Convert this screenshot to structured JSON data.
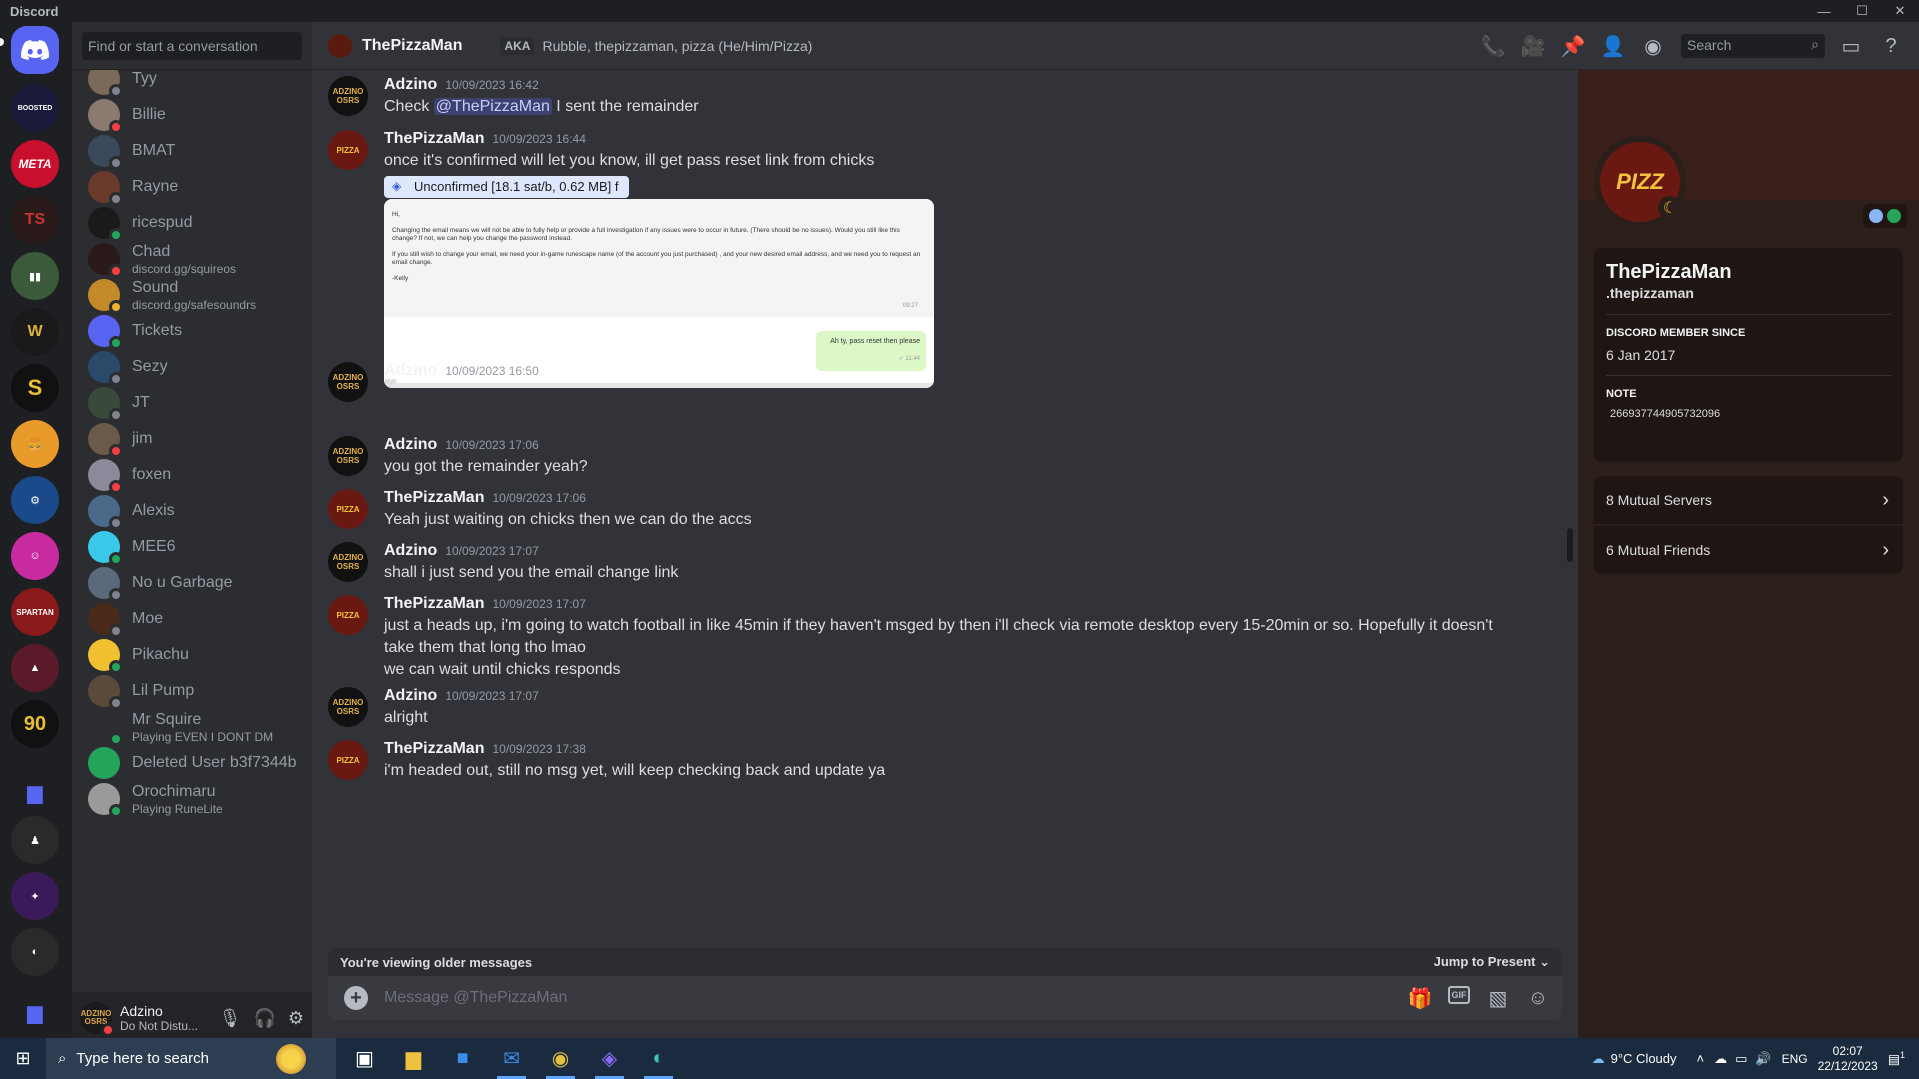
{
  "window": {
    "app_name": "Discord",
    "minimize": "—",
    "maximize": "☐",
    "close": "✕"
  },
  "sidebar": {
    "search_placeholder": "Find or start a conversation",
    "dms": [
      {
        "name": "Tyy",
        "sub": "",
        "color": "#7a6a5a",
        "status": "#80848e"
      },
      {
        "name": "Billie",
        "sub": "",
        "color": "#8a7a70",
        "status": "#f23f43"
      },
      {
        "name": "BMAT",
        "sub": "",
        "color": "#3a4a5a",
        "status": "#80848e"
      },
      {
        "name": "Rayne",
        "sub": "",
        "color": "#6a3a2a",
        "status": "#80848e"
      },
      {
        "name": "ricespud",
        "sub": "",
        "color": "#1a1a1a",
        "status": "#23a55a"
      },
      {
        "name": "Chad",
        "sub": "discord.gg/squireos",
        "color": "#2a1a1a",
        "status": "#f23f43"
      },
      {
        "name": "Sound",
        "sub": "discord.gg/safesoundrs",
        "color": "#c48a2a",
        "status": "#f0b232"
      },
      {
        "name": "Tickets",
        "sub": "",
        "color": "#5865f2",
        "status": "#23a55a"
      },
      {
        "name": "Sezy",
        "sub": "",
        "color": "#2a4a6a",
        "status": "#80848e"
      },
      {
        "name": "JT",
        "sub": "",
        "color": "#3a4a3a",
        "status": "#80848e"
      },
      {
        "name": "jim",
        "sub": "",
        "color": "#6a5a4a",
        "status": "#f23f43"
      },
      {
        "name": "foxen",
        "sub": "",
        "color": "#8a8a9a",
        "status": "#f23f43"
      },
      {
        "name": "Alexis",
        "sub": "",
        "color": "#4a6a8a",
        "status": "#80848e"
      },
      {
        "name": "MEE6",
        "sub": "",
        "color": "#3ac8e8",
        "status": "#23a55a"
      },
      {
        "name": "No u Garbage",
        "sub": "",
        "color": "#5a6a7a",
        "status": "#80848e"
      },
      {
        "name": "Moe",
        "sub": "",
        "color": "#4a2a1a",
        "status": "#80848e"
      },
      {
        "name": "Pikachu",
        "sub": "",
        "color": "#f0c030",
        "status": "#23a55a"
      },
      {
        "name": "Lil Pump",
        "sub": "",
        "color": "#5a4a3a",
        "status": "#80848e"
      },
      {
        "name": "Mr Squire",
        "sub": "Playing EVEN I DONT DM",
        "color": "#2b2d31",
        "status": "#23a55a"
      },
      {
        "name": "Deleted User b3f7344b",
        "sub": "",
        "color": "#23a55a",
        "status": ""
      },
      {
        "name": "Orochimaru",
        "sub": "Playing RuneLite",
        "color": "#9a9a9a",
        "status": "#23a55a"
      }
    ]
  },
  "user": {
    "name": "Adzino",
    "status": "Do Not Distu...",
    "avatar_text": "ADZINO OSRS"
  },
  "header": {
    "title": "ThePizzaMan",
    "aka_label": "AKA",
    "aka_text": "Rubble, thepizzaman, pizza (He/Him/Pizza)",
    "search_placeholder": "Search"
  },
  "messages": [
    {
      "author": "Adzino",
      "ts": "10/09/2023 16:42",
      "pre": "Check ",
      "mention": "@ThePizzaMan",
      "post": " I sent the remainder"
    },
    {
      "author": "ThePizzaMan",
      "ts": "10/09/2023 16:44",
      "text": "once it's confirmed will let you know, ill get pass reset link from chicks"
    },
    {
      "author": "Adzino",
      "ts": "10/09/2023 16:50"
    },
    {
      "author": "Adzino",
      "ts": "10/09/2023 17:06",
      "text": "you  got the remainder yeah?"
    },
    {
      "author": "ThePizzaMan",
      "ts": "10/09/2023 17:06",
      "text": "Yeah just waiting on chicks then we can do the accs"
    },
    {
      "author": "Adzino",
      "ts": "10/09/2023 17:07",
      "text": "shall i just send you the email change link"
    },
    {
      "author": "ThePizzaMan",
      "ts": "10/09/2023 17:07",
      "text": "just a heads up, i'm going to watch football in like 45min if they haven't msged by then i'll check via remote desktop every 15-20min or so. Hopefully it doesn't take them that long tho lmao",
      "text2": "we can wait until chicks responds"
    },
    {
      "author": "Adzino",
      "ts": "10/09/2023 17:07",
      "text": "alright"
    },
    {
      "author": "ThePizzaMan",
      "ts": "10/09/2023 17:38",
      "text": "i'm headed out, still no msg yet, will keep checking back and update ya"
    }
  ],
  "avatars": {
    "adzino": "ADZINO OSRS",
    "pizza": "PIZZA"
  },
  "heart_emoji": "❤",
  "tooltip_chip": "Unconfirmed [18.1 sat/b, 0.62 MB]  f",
  "embed": {
    "greeting": "Hi,",
    "p1": "Changing the email means we will not be able to fully help or provide a full investigation if any issues were to occur in future. (There should be no issues). Would you still like this change? If not, we can help you change the password instead.",
    "p2": "If you still wish to change your email, we need your in-game runescape name (of the account you just purchased) , and your new desired email address, and we need you to request an email change.",
    "sign": "-Kelly",
    "time1": "09:27",
    "reply": "Ah ty, pass reset then please",
    "time2": "✓ 11:44"
  },
  "older": {
    "label": "You're viewing older messages",
    "jump": "Jump to Present"
  },
  "composer": {
    "placeholder": "Message @ThePizzaMan",
    "gif": "GIF"
  },
  "profile": {
    "display_name": "ThePizzaMan",
    "username": ".thepizzaman",
    "avatar_text": "PIZZ",
    "member_label": "DISCORD MEMBER SINCE",
    "member_since": "6 Jan 2017",
    "note_label": "NOTE",
    "note": "266937744905732096",
    "mutual_servers": "8 Mutual Servers",
    "mutual_friends": "6 Mutual Friends"
  },
  "taskbar": {
    "search_placeholder": "Type here to search",
    "weather": "9°C  Cloudy",
    "lang": "ENG",
    "time": "02:07",
    "date": "22/12/2023",
    "notif_count": "1"
  }
}
